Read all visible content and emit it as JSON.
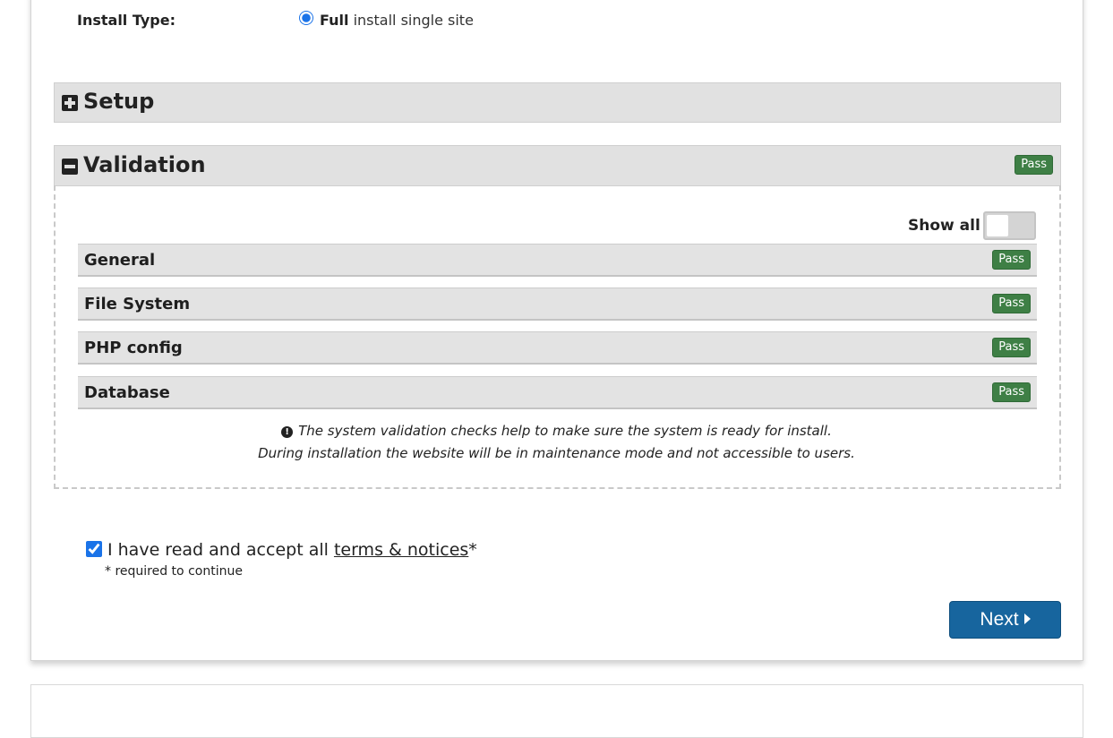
{
  "install": {
    "label": "Install Type:",
    "option_bold": "Full",
    "option_rest": " install single site",
    "selected": true
  },
  "setup": {
    "title": "Setup",
    "state": "collapsed",
    "icon": "plus-square-icon"
  },
  "validation": {
    "title": "Validation",
    "state": "expanded",
    "icon": "minus-square-icon",
    "status": "Pass",
    "show_all_label": "Show all",
    "show_all_on": false,
    "checks": [
      {
        "label": "General",
        "status": "Pass"
      },
      {
        "label": "File System",
        "status": "Pass"
      },
      {
        "label": "PHP config",
        "status": "Pass"
      },
      {
        "label": "Database",
        "status": "Pass"
      }
    ],
    "info_line1": "The system validation checks help to make sure the system is ready for install.",
    "info_line2": "During installation the website will be in maintenance mode and not accessible to users."
  },
  "terms": {
    "checked": true,
    "text": "I have read and accept all ",
    "link": "terms & notices",
    "asterisk": "*",
    "required_note": "* required to continue"
  },
  "next_button": {
    "label": "Next"
  },
  "colors": {
    "pass_badge": "#3e7f45",
    "primary_button": "#17659e",
    "panel_header": "#e1e1e1"
  }
}
